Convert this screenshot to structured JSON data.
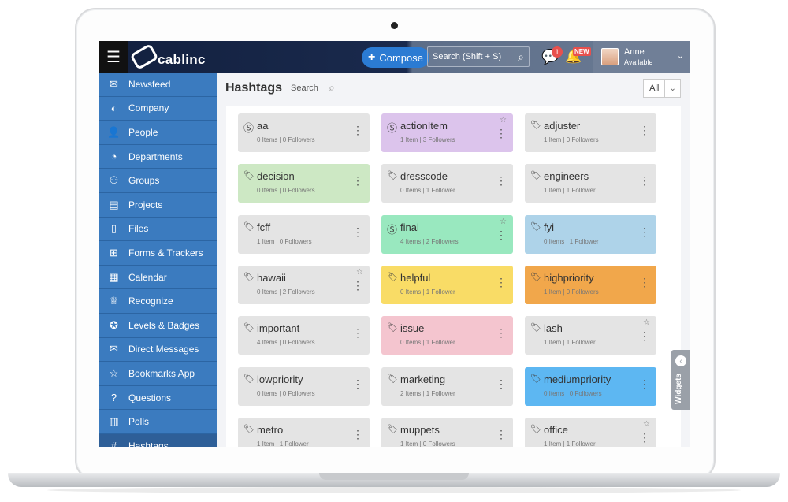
{
  "app": {
    "logo_text": "cablinc"
  },
  "header": {
    "compose_label": "Compose",
    "search_placeholder": "Search (Shift + S)",
    "chat_badge_count": "1",
    "new_badge": "NEW",
    "user_name": "Anne",
    "user_status": "Available"
  },
  "sidebar": {
    "items": [
      {
        "label": "Newsfeed",
        "icon": "inbox-icon"
      },
      {
        "label": "Company",
        "icon": "globe-icon"
      },
      {
        "label": "People",
        "icon": "user-icon"
      },
      {
        "label": "Departments",
        "icon": "pie-chart-icon"
      },
      {
        "label": "Groups",
        "icon": "group-icon"
      },
      {
        "label": "Projects",
        "icon": "briefcase-icon"
      },
      {
        "label": "Files",
        "icon": "file-icon"
      },
      {
        "label": "Forms & Trackers",
        "icon": "table-icon"
      },
      {
        "label": "Calendar",
        "icon": "calendar-icon"
      },
      {
        "label": "Recognize",
        "icon": "trophy-icon"
      },
      {
        "label": "Levels & Badges",
        "icon": "badge-icon"
      },
      {
        "label": "Direct Messages",
        "icon": "envelope-icon"
      },
      {
        "label": "Bookmarks App",
        "icon": "star-icon"
      },
      {
        "label": "Questions",
        "icon": "question-icon"
      },
      {
        "label": "Polls",
        "icon": "bar-chart-icon"
      },
      {
        "label": "Hashtags",
        "icon": "hashtag-icon"
      }
    ]
  },
  "main": {
    "title": "Hashtags",
    "search_label": "Search",
    "filter_value": "All"
  },
  "hashtags": [
    {
      "name": "aa",
      "meta": "0 Items | 0 Followers",
      "color": "#e4e4e4",
      "icon": "s"
    },
    {
      "name": "actionItem",
      "meta": "1 Item | 3 Followers",
      "color": "#dcc4ec",
      "icon": "s",
      "star": true
    },
    {
      "name": "adjuster",
      "meta": "1 Item | 0 Followers",
      "color": "#e4e4e4",
      "icon": "tag"
    },
    {
      "name": "decision",
      "meta": "0 Items | 0 Followers",
      "color": "#cde8c4",
      "icon": "tag"
    },
    {
      "name": "dresscode",
      "meta": "0 Items | 1 Follower",
      "color": "#e4e4e4",
      "icon": "tag"
    },
    {
      "name": "engineers",
      "meta": "1 Item | 1 Follower",
      "color": "#e4e4e4",
      "icon": "tag"
    },
    {
      "name": "fcff",
      "meta": "1 Item | 0 Followers",
      "color": "#e4e4e4",
      "icon": "tag"
    },
    {
      "name": "final",
      "meta": "4 Items | 2 Followers",
      "color": "#99e8bf",
      "icon": "s",
      "star": true
    },
    {
      "name": "fyi",
      "meta": "0 Items | 1 Follower",
      "color": "#aed3e9",
      "icon": "tag"
    },
    {
      "name": "hawaii",
      "meta": "0 Items | 2 Followers",
      "color": "#e4e4e4",
      "icon": "tag",
      "star": true
    },
    {
      "name": "helpful",
      "meta": "0 Items | 1 Follower",
      "color": "#f9dc66",
      "icon": "tag"
    },
    {
      "name": "highpriority",
      "meta": "1 Item | 0 Followers",
      "color": "#f1a74b",
      "icon": "tag"
    },
    {
      "name": "important",
      "meta": "4 Items | 0 Followers",
      "color": "#e4e4e4",
      "icon": "tag"
    },
    {
      "name": "issue",
      "meta": "0 Items | 1 Follower",
      "color": "#f4c5cf",
      "icon": "tag"
    },
    {
      "name": "lash",
      "meta": "1 Item | 1 Follower",
      "color": "#e4e4e4",
      "icon": "tag",
      "star": true
    },
    {
      "name": "lowpriority",
      "meta": "0 Items | 0 Followers",
      "color": "#e4e4e4",
      "icon": "tag"
    },
    {
      "name": "marketing",
      "meta": "2 Items | 1 Follower",
      "color": "#e4e4e4",
      "icon": "tag"
    },
    {
      "name": "mediumpriority",
      "meta": "0 Items | 0 Followers",
      "color": "#5db7f2",
      "icon": "tag"
    },
    {
      "name": "metro",
      "meta": "1 Item | 1 Follower",
      "color": "#e4e4e4",
      "icon": "tag"
    },
    {
      "name": "muppets",
      "meta": "1 Item | 0 Followers",
      "color": "#e4e4e4",
      "icon": "tag"
    },
    {
      "name": "office",
      "meta": "1 Item | 1 Follower",
      "color": "#e4e4e4",
      "icon": "tag",
      "star": true
    }
  ],
  "widgets_label": "Widgets"
}
